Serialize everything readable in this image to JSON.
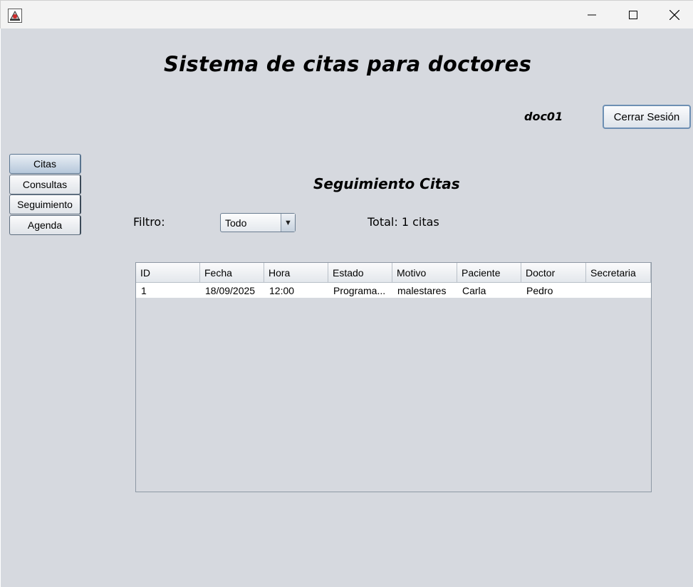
{
  "app": {
    "title": "Sistema de citas para doctores",
    "user": "doc01",
    "logout_label": "Cerrar Sesión"
  },
  "window_controls": {
    "minimize_icon": "minimize-icon",
    "maximize_icon": "maximize-icon",
    "close_icon": "close-icon",
    "app_icon": "java-app-icon"
  },
  "nav": {
    "items": [
      {
        "label": "Citas",
        "active": true
      },
      {
        "label": "Consultas",
        "active": false
      },
      {
        "label": "Seguimiento",
        "active": false
      },
      {
        "label": "Agenda",
        "active": false
      }
    ]
  },
  "main": {
    "section_title": "Seguimiento Citas",
    "filter_label": "Filtro:",
    "filter_value": "Todo",
    "total_text": "Total: 1 citas"
  },
  "table": {
    "headers": [
      "ID",
      "Fecha",
      "Hora",
      "Estado",
      "Motivo",
      "Paciente",
      "Doctor",
      "Secretaria"
    ],
    "rows": [
      [
        "1",
        "18/09/2025",
        "12:00",
        "Programa...",
        "malestares",
        "Carla",
        "Pedro",
        ""
      ]
    ]
  },
  "colors": {
    "background": "#d6d9df",
    "button_border": "#6d8fb3",
    "active_nav": "#b6c8db"
  }
}
